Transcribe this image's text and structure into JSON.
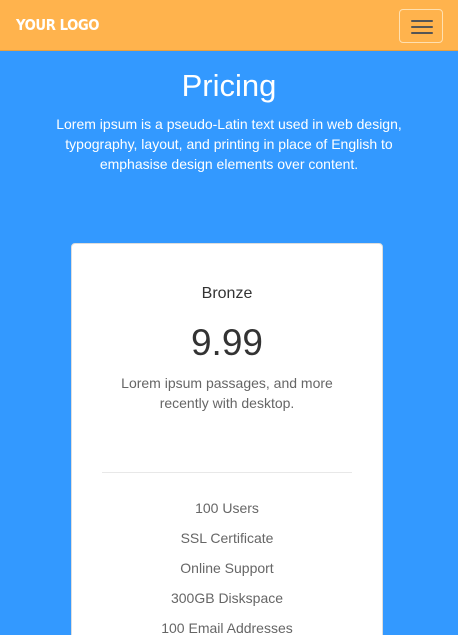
{
  "navbar": {
    "logo": "YOUR LOGO",
    "toggle_icon": "hamburger-menu-icon",
    "background": "#ffb34d"
  },
  "header": {
    "title": "Pricing",
    "intro": "Lorem ipsum is a pseudo-Latin text used in web design, typography, layout, and printing in place of English to emphasise design elements over content."
  },
  "plan": {
    "name": "Bronze",
    "price": "9.99",
    "description": "Lorem ipsum passages, and more recently with desktop.",
    "features": [
      "100 Users",
      "SSL Certificate",
      "Online Support",
      "300GB Diskspace",
      "100 Email Addresses"
    ]
  },
  "colors": {
    "page_background": "#3399ff",
    "navbar": "#ffb34d",
    "card": "#ffffff"
  }
}
